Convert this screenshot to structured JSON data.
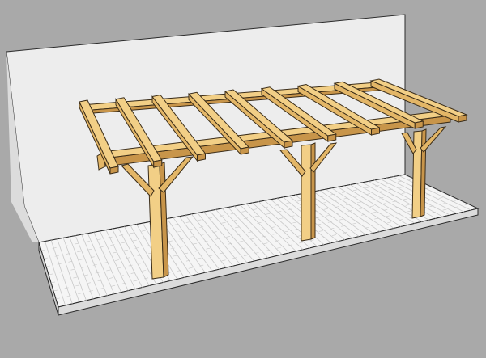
{
  "scene": {
    "subject": "wooden-pergola-3d-model",
    "colors": {
      "background": "#a9a9a9",
      "wall": "#ededed",
      "wall_shadow": "#d9d9d9",
      "deck": "#f4f4f4",
      "deck_lines": "#c8c8c8",
      "deck_side": "#dcdcdc",
      "wood_light": "#f2cf86",
      "wood_mid": "#e3b667",
      "wood_dark": "#c8954a",
      "edge": "#3a2c18"
    },
    "rafter_count": 9,
    "post_count": 3
  }
}
